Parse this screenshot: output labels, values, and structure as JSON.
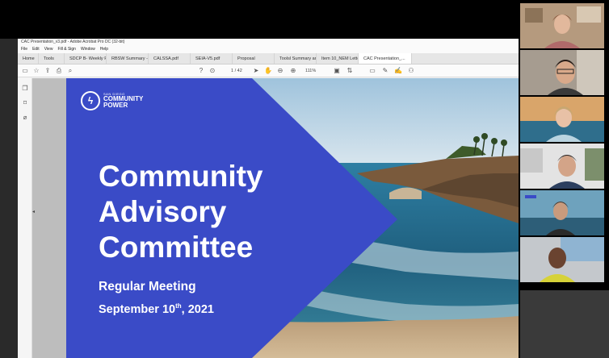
{
  "window": {
    "title": "CAC Presentation_v3.pdf - Adobe Acrobat Pro DC (32-bit)",
    "menu": [
      "File",
      "Edit",
      "View",
      "Fill & Sign",
      "Window",
      "Help"
    ]
  },
  "tabs": [
    {
      "label": "Home"
    },
    {
      "label": "Tools"
    },
    {
      "label": "SDCP B- Weekly Re..."
    },
    {
      "label": "RBSW Summary - ..."
    },
    {
      "label": "CALSSA.pdf"
    },
    {
      "label": "SEIA-V5.pdf"
    },
    {
      "label": "Proposal"
    },
    {
      "label": "Toolsl Summary an..."
    },
    {
      "label": "Item 10_NEM Lette..."
    },
    {
      "label": "CAC Presentation_..."
    }
  ],
  "toolbar": {
    "page_current": "1",
    "page_total": "/ 42",
    "zoom": "111%"
  },
  "slide": {
    "logo_small": "SAN DIEGO",
    "logo_line1": "COMMUNITY",
    "logo_line2": "POWER",
    "title_line1": "Community",
    "title_line2": "Advisory",
    "title_line3": "Committee",
    "subtitle": "Regular Meeting",
    "date_prefix": "September 10",
    "date_sup": "th",
    "date_suffix": ", 2021"
  },
  "colors": {
    "slide_blue": "#3a4bc7",
    "ocean": "#2b6f93",
    "sky": "#c7dbe8"
  },
  "icons": [
    "save-icon",
    "bookmark-star-icon",
    "upload-icon",
    "print-icon",
    "search-icon",
    "help-icon",
    "download-icon",
    "cursor-icon",
    "hand-icon",
    "zoom-out-icon",
    "zoom-in-icon",
    "comment-icon",
    "pen-icon",
    "sign-icon"
  ]
}
